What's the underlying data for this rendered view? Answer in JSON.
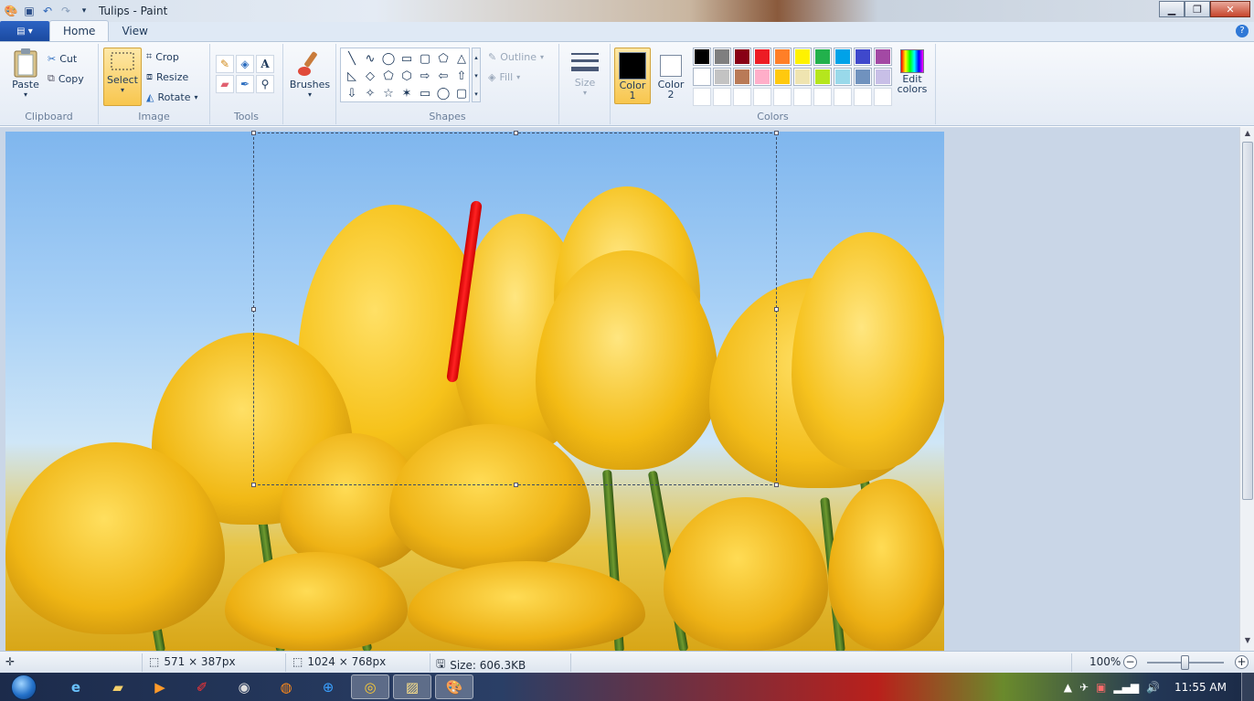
{
  "window": {
    "title": "Tulips - Paint",
    "controls": [
      "minimize-icon",
      "maximize-icon",
      "close-icon"
    ]
  },
  "tabs": [
    {
      "label": "Home",
      "active": true
    },
    {
      "label": "View",
      "active": false
    }
  ],
  "ribbon": {
    "clipboard": {
      "label": "Clipboard",
      "paste": "Paste",
      "cut": "Cut",
      "copy": "Copy"
    },
    "image": {
      "label": "Image",
      "select": "Select",
      "crop": "Crop",
      "resize": "Resize",
      "rotate": "Rotate"
    },
    "tools": {
      "label": "Tools",
      "items": [
        "pencil-icon",
        "fill-icon",
        "text-icon",
        "eraser-icon",
        "color-picker-icon",
        "magnifier-icon"
      ]
    },
    "brushes": {
      "label": "Brushes"
    },
    "shapes": {
      "label": "Shapes",
      "outline": "Outline",
      "fill": "Fill",
      "items": [
        "╲",
        "∿",
        "◯",
        "▭",
        "▢",
        "⬠",
        "△",
        "◺",
        "◇",
        "⬠",
        "⬡",
        "⇨",
        "⇦",
        "⇧",
        "⇩",
        "✧",
        "☆",
        "✶",
        "▭",
        "◯",
        "▢"
      ]
    },
    "size": {
      "label": "Size"
    },
    "color1": {
      "line1": "Color",
      "line2": "1",
      "value": "#000000"
    },
    "color2": {
      "line1": "Color",
      "line2": "2",
      "value": "#ffffff"
    },
    "colors": {
      "label": "Colors",
      "palette": [
        "#000000",
        "#7f7f7f",
        "#880015",
        "#ed1c24",
        "#ff7f27",
        "#fff200",
        "#22b14c",
        "#00a2e8",
        "#3f48cc",
        "#a349a4",
        "#ffffff",
        "#c3c3c3",
        "#b97a57",
        "#ffaec9",
        "#ffc90e",
        "#efe4b0",
        "#b5e61d",
        "#99d9ea",
        "#7092be",
        "#c8bfe7",
        "",
        "",
        "",
        "",
        "",
        "",
        "",
        "",
        "",
        ""
      ]
    },
    "edit_colors": {
      "line1": "Edit",
      "line2": "colors"
    }
  },
  "status": {
    "selection_size": "571 × 387px",
    "image_size": "1024 × 768px",
    "file_size": "Size: 606.3KB",
    "zoom": "100%",
    "zoom_level": 1.0
  },
  "taskbar": {
    "apps": [
      "ie-icon",
      "explorer-icon",
      "media-player-icon",
      "pin-icon",
      "settings-icon",
      "firefox-icon",
      "maxthon-icon",
      "chrome-icon",
      "photos-icon",
      "paint-icon"
    ],
    "clock": "11:55 AM"
  }
}
